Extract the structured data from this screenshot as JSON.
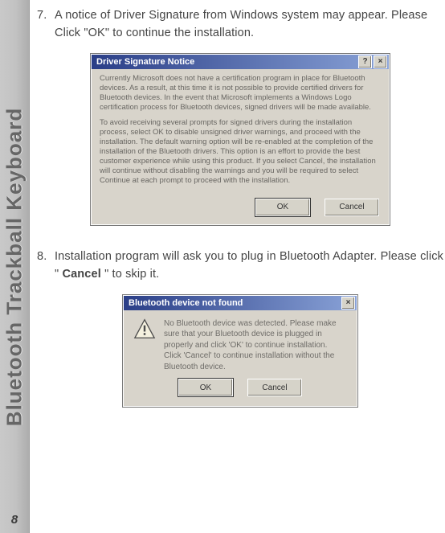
{
  "sidebar": {
    "title": "Bluetooth Trackball Keyboard",
    "page_number": "8"
  },
  "steps": [
    {
      "number": "7.",
      "text_a": "A notice of Driver Signature from Windows system may appear.  Please Click \"OK\" to continue the installation."
    },
    {
      "number": "8.",
      "text_a": "Installation program will ask you to plug in Bluetooth Adapter. Please click \" ",
      "bold": "Cancel",
      "text_b": " \" to skip it."
    }
  ],
  "dialog1": {
    "title": "Driver Signature Notice",
    "help_glyph": "?",
    "close_glyph": "×",
    "para1": "Currently Microsoft does not have a certification program in place for Bluetooth devices. As a result, at this time it is not possible to provide certified drivers for Bluetooth devices. In the event that Microsoft implements a Windows Logo certification process for Bluetooth devices, signed drivers will be made available.",
    "para2": "To avoid receiving several prompts for signed drivers during the installation process, select OK to disable unsigned driver warnings, and proceed with the installation. The default warning option will be re-enabled at the completion of the installation of the Bluetooth drivers. This option is an effort to provide the best customer experience while using this product. If you select Cancel, the installation will continue without disabling the warnings and you will be required to select Continue at each prompt to proceed with the installation.",
    "ok": "OK",
    "cancel": "Cancel"
  },
  "dialog2": {
    "title": "Bluetooth device not found",
    "close_glyph": "×",
    "message": "No Bluetooth device was detected. Please make sure that your Bluetooth device is plugged in properly and click 'OK' to continue installation. Click 'Cancel' to continue installation without the Bluetooth device.",
    "ok": "OK",
    "cancel": "Cancel"
  }
}
